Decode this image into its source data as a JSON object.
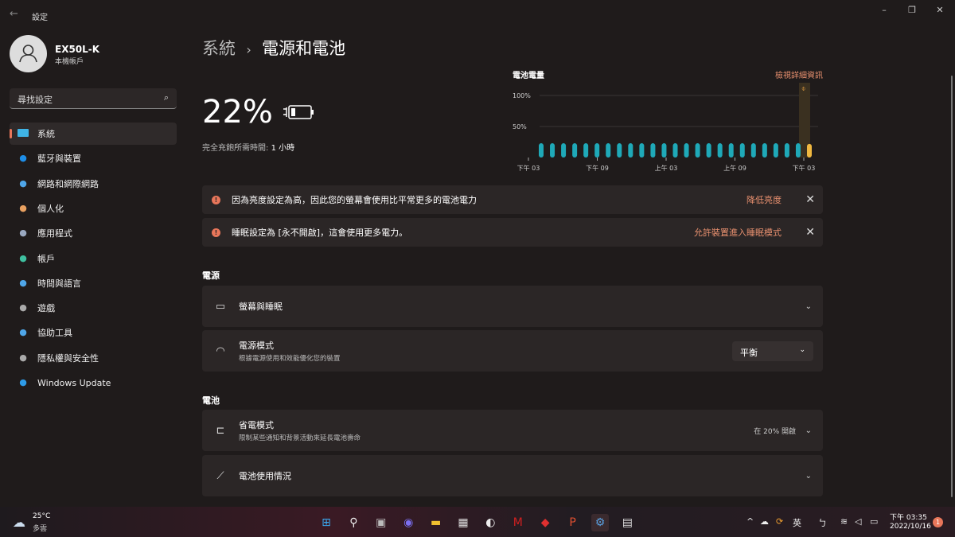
{
  "window": {
    "title": "設定",
    "minimize": "–",
    "maximize": "❐",
    "close": "✕",
    "back": "←"
  },
  "user": {
    "name": "EX50L-K",
    "type": "本機帳戶"
  },
  "search": {
    "placeholder": "尋找設定",
    "icon": "search-icon"
  },
  "sidebar": {
    "items": [
      {
        "label": "系統",
        "icon": "monitor-icon",
        "color": "#3fb4e6",
        "active": true
      },
      {
        "label": "藍牙與裝置",
        "icon": "bluetooth-icon",
        "color": "#1e8ee8"
      },
      {
        "label": "網路和網際網路",
        "icon": "wifi-icon",
        "color": "#4fa6e8"
      },
      {
        "label": "個人化",
        "icon": "brush-icon",
        "color": "#e8a060"
      },
      {
        "label": "應用程式",
        "icon": "apps-icon",
        "color": "#9aa8c0"
      },
      {
        "label": "帳戶",
        "icon": "person-icon",
        "color": "#3fc0a0"
      },
      {
        "label": "時間與語言",
        "icon": "globe-clock-icon",
        "color": "#4fa6e8"
      },
      {
        "label": "遊戲",
        "icon": "gamepad-icon",
        "color": "#aaa"
      },
      {
        "label": "協助工具",
        "icon": "accessibility-icon",
        "color": "#4fa6e8"
      },
      {
        "label": "隱私權與安全性",
        "icon": "shield-icon",
        "color": "#aaa"
      },
      {
        "label": "Windows Update",
        "icon": "update-icon",
        "color": "#2e9be8"
      }
    ]
  },
  "breadcrumb": {
    "parent": "系統",
    "sep": "›",
    "current": "電源和電池"
  },
  "battery": {
    "percent": "22%",
    "charge_text": "完全充飽所需時間:",
    "charge_time": "1 小時"
  },
  "chart_data": {
    "type": "bar",
    "title": "電池電量",
    "link": "檢視詳細資訊",
    "yticks": [
      "100%",
      "50%"
    ],
    "ylim": [
      0,
      100
    ],
    "xticks": [
      "下午 03",
      "下午 09",
      "上午 03",
      "上午 09",
      "下午 03"
    ],
    "values": [
      23,
      23,
      23,
      23,
      23,
      23,
      23,
      23,
      23,
      23,
      23,
      23,
      23,
      23,
      23,
      23,
      23,
      23,
      23,
      23,
      23,
      23,
      23,
      23,
      22
    ],
    "colors": {
      "bar": "#1fa9b8",
      "current": "#f0b840"
    }
  },
  "alerts": [
    {
      "text": "因為亮度設定為高，因此您的螢幕會使用比平常更多的電池電力",
      "action": "降低亮度"
    },
    {
      "text": "睡眠設定為 [永不開啟]，這會使用更多電力。",
      "action": "允許裝置進入睡眠模式"
    }
  ],
  "power": {
    "heading": "電源",
    "screen_sleep": "螢幕與睡眠",
    "mode_title": "電源模式",
    "mode_sub": "根據電源使用和效能優化您的裝置",
    "mode_value": "平衡"
  },
  "batterySection": {
    "heading": "電池",
    "saver_title": "省電模式",
    "saver_sub": "限制某些通知和背景活動來延長電池壽命",
    "saver_value": "在 20% 開啟",
    "usage": "電池使用情況"
  },
  "accent": "#e8765a",
  "taskbar": {
    "weather_temp": "25°C",
    "weather_desc": "多雲",
    "ime": "英",
    "time": "下午 03:35",
    "date": "2022/10/16",
    "notif": "1",
    "apps": [
      "start-icon",
      "search-icon",
      "task-view-icon",
      "teams-chat-icon",
      "file-explorer-icon",
      "store-icon",
      "app-icon",
      "mcafee-icon",
      "app-icon",
      "powerpoint-icon",
      "settings-icon",
      "snipping-icon"
    ]
  }
}
